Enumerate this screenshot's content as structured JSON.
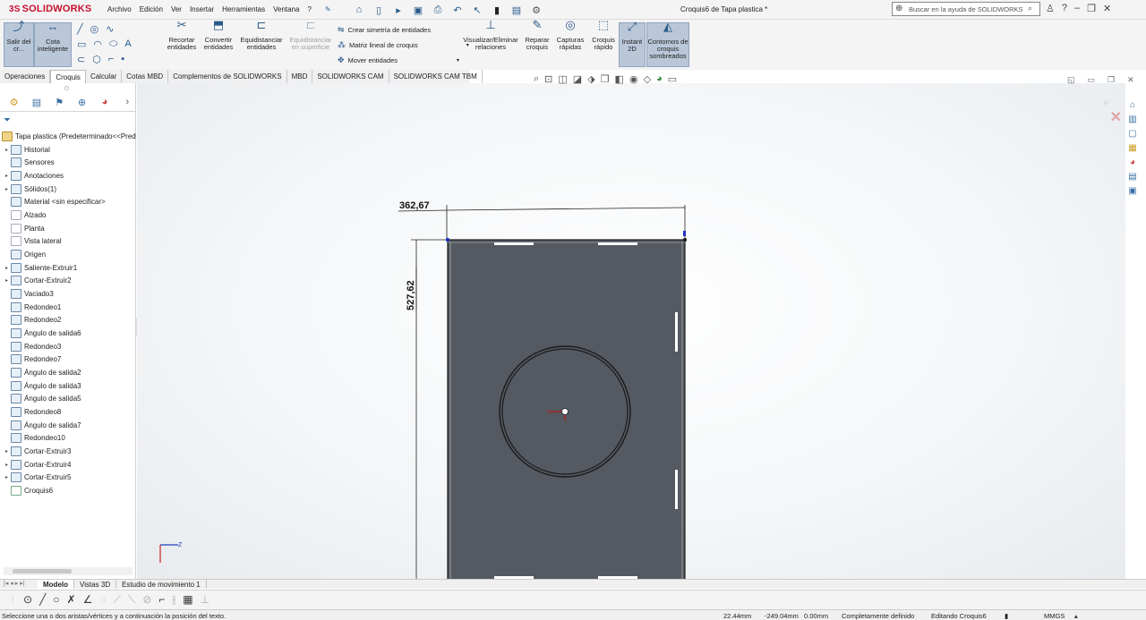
{
  "app": {
    "brand": "SOLIDWORKS",
    "menus": [
      "Archivo",
      "Edición",
      "Ver",
      "Insertar",
      "Herramientas",
      "Ventana",
      "?"
    ],
    "document_title": "Croquis6 de Tapa plastica *",
    "help_search_placeholder": "Buscar en la ayuda de SOLIDWORKS"
  },
  "ribbon": {
    "exit_sketch": "Salir del cr...",
    "smart_dimension": "Cota inteligente",
    "trim": "Recortar entidades",
    "convert": "Convertir entidades",
    "offset": "Equidistanciar entidades",
    "offset_surface": "Equidistanciar en superficie",
    "mirror": "Crear simetría de entidades",
    "linear_pattern": "Matriz lineal de croquis",
    "move": "Mover entidades",
    "relations": "Visualizar/Eliminar relaciones",
    "repair": "Reparar croquis",
    "quick_snaps": "Capturas rápidas",
    "rapid_sketch": "Croquis rápido",
    "instant2d": "Instant 2D",
    "shaded_contours": "Contornos de croquis sombreados"
  },
  "command_tabs": [
    "Operaciones",
    "Croquis",
    "Calcular",
    "Cotas MBD",
    "Complementos de SOLIDWORKS",
    "MBD",
    "SOLIDWORKS CAM",
    "SOLIDWORKS CAM TBM"
  ],
  "active_command_tab": "Croquis",
  "tree": {
    "root": "Tapa plastica  (Predeterminado<<Pred",
    "items": [
      {
        "label": "Historial",
        "icon": "history-icon",
        "expand": true
      },
      {
        "label": "Sensores",
        "icon": "sensors-icon",
        "expand": false
      },
      {
        "label": "Anotaciones",
        "icon": "annotations-icon",
        "expand": true
      },
      {
        "label": "Sólidos(1)",
        "icon": "solid-bodies-icon",
        "expand": true
      },
      {
        "label": "Material <sin especificar>",
        "icon": "material-icon",
        "expand": false
      },
      {
        "label": "Alzado",
        "icon": "plane-icon",
        "expand": false
      },
      {
        "label": "Planta",
        "icon": "plane-icon",
        "expand": false
      },
      {
        "label": "Vista lateral",
        "icon": "plane-icon",
        "expand": false
      },
      {
        "label": "Origen",
        "icon": "origin-icon",
        "expand": false
      },
      {
        "label": "Saliente-Extruir1",
        "icon": "extrude-icon",
        "expand": true
      },
      {
        "label": "Cortar-Extruir2",
        "icon": "cut-extrude-icon",
        "expand": true
      },
      {
        "label": "Vaciado3",
        "icon": "shell-icon",
        "expand": false
      },
      {
        "label": "Redondeo1",
        "icon": "fillet-icon",
        "expand": false
      },
      {
        "label": "Redondeo2",
        "icon": "fillet-icon",
        "expand": false
      },
      {
        "label": "Ángulo de salida6",
        "icon": "draft-icon",
        "expand": false
      },
      {
        "label": "Redondeo3",
        "icon": "fillet-icon",
        "expand": false
      },
      {
        "label": "Redondeo7",
        "icon": "fillet-icon",
        "expand": false
      },
      {
        "label": "Ángulo de salida2",
        "icon": "draft-icon",
        "expand": false
      },
      {
        "label": "Ángulo de salida3",
        "icon": "draft-icon",
        "expand": false
      },
      {
        "label": "Ángulo de salida5",
        "icon": "draft-icon",
        "expand": false
      },
      {
        "label": "Redondeo8",
        "icon": "fillet-icon",
        "expand": false
      },
      {
        "label": "Ángulo de salida7",
        "icon": "draft-icon",
        "expand": false
      },
      {
        "label": "Redondeo10",
        "icon": "fillet-icon",
        "expand": false
      },
      {
        "label": "Cortar-Extruir3",
        "icon": "cut-extrude-icon",
        "expand": true
      },
      {
        "label": "Cortar-Extruir4",
        "icon": "cut-extrude-icon",
        "expand": true
      },
      {
        "label": "Cortar-Extruir5",
        "icon": "cut-extrude-icon",
        "expand": true
      },
      {
        "label": "Croquis6",
        "icon": "sketch-icon",
        "expand": false
      }
    ]
  },
  "drawing": {
    "dim_width": "362,67",
    "dim_height": "527,62",
    "triad_label": "Z"
  },
  "bottom_tabs": [
    "Modelo",
    "Vistas 3D",
    "Estudio de movimiento 1"
  ],
  "active_bottom_tab": "Modelo",
  "status": {
    "message": "Seleccione una o dos aristas/vértices y a continuación la posición del texto.",
    "x": "22.44mm",
    "y": "-249.04mm",
    "z": "0.00mm",
    "state": "Completamente definido",
    "editing": "Editando Croquis6",
    "units": "MMGS"
  }
}
